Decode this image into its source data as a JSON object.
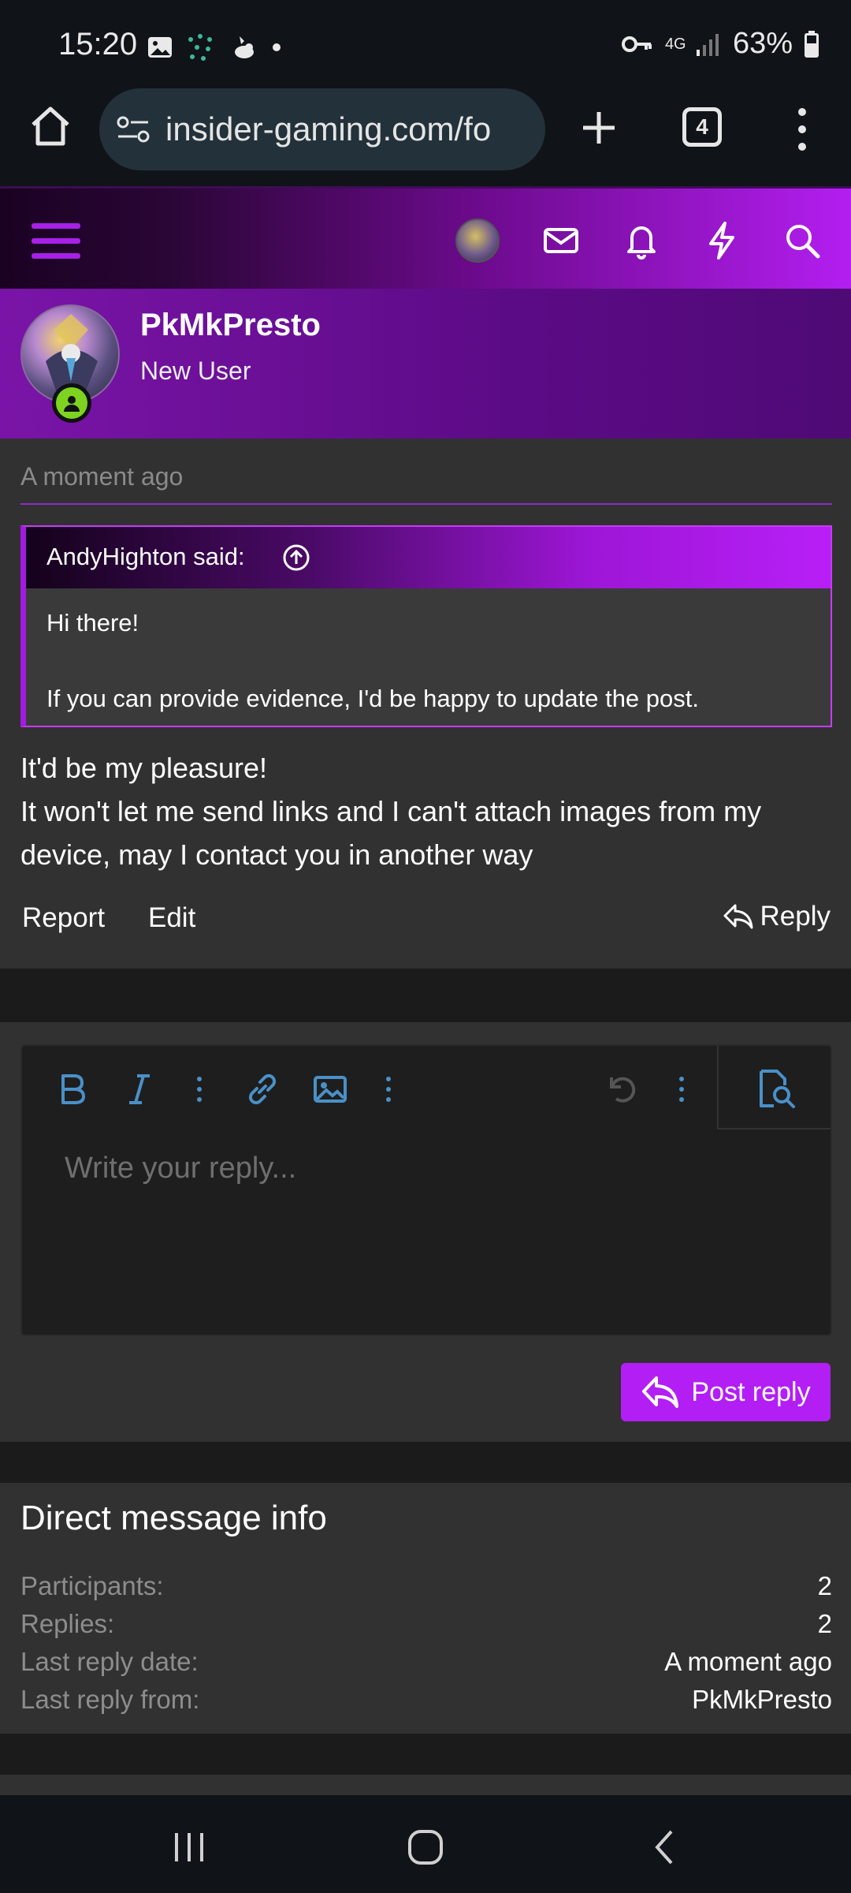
{
  "status_bar": {
    "time": "15:20",
    "network": "4G",
    "battery": "63%"
  },
  "browser": {
    "url": "insider-gaming.com/fo",
    "tab_count": "4"
  },
  "profile": {
    "name": "PkMkPresto",
    "role": "New User"
  },
  "message": {
    "timestamp": "A moment ago",
    "quote": {
      "author": "AndyHighton said:",
      "line1": "Hi there!",
      "line2": "If you can provide evidence, I'd be happy to update the post."
    },
    "text_line1": "It'd be my pleasure!",
    "text_line2": "It won't let me send links and I can't attach images from my device, may I contact you in another way",
    "actions": {
      "report": "Report",
      "edit": "Edit",
      "reply": "Reply"
    }
  },
  "editor": {
    "placeholder": "Write your reply...",
    "post_button": "Post reply"
  },
  "info": {
    "title": "Direct message info",
    "rows": [
      {
        "label": "Participants:",
        "value": "2"
      },
      {
        "label": "Replies:",
        "value": "2"
      },
      {
        "label": "Last reply date:",
        "value": "A moment ago"
      },
      {
        "label": "Last reply from:",
        "value": "PkMkPresto"
      }
    ]
  },
  "colors": {
    "accent": "#b31ef5",
    "editor_icon": "#4a90c8",
    "online": "#7ed320"
  }
}
